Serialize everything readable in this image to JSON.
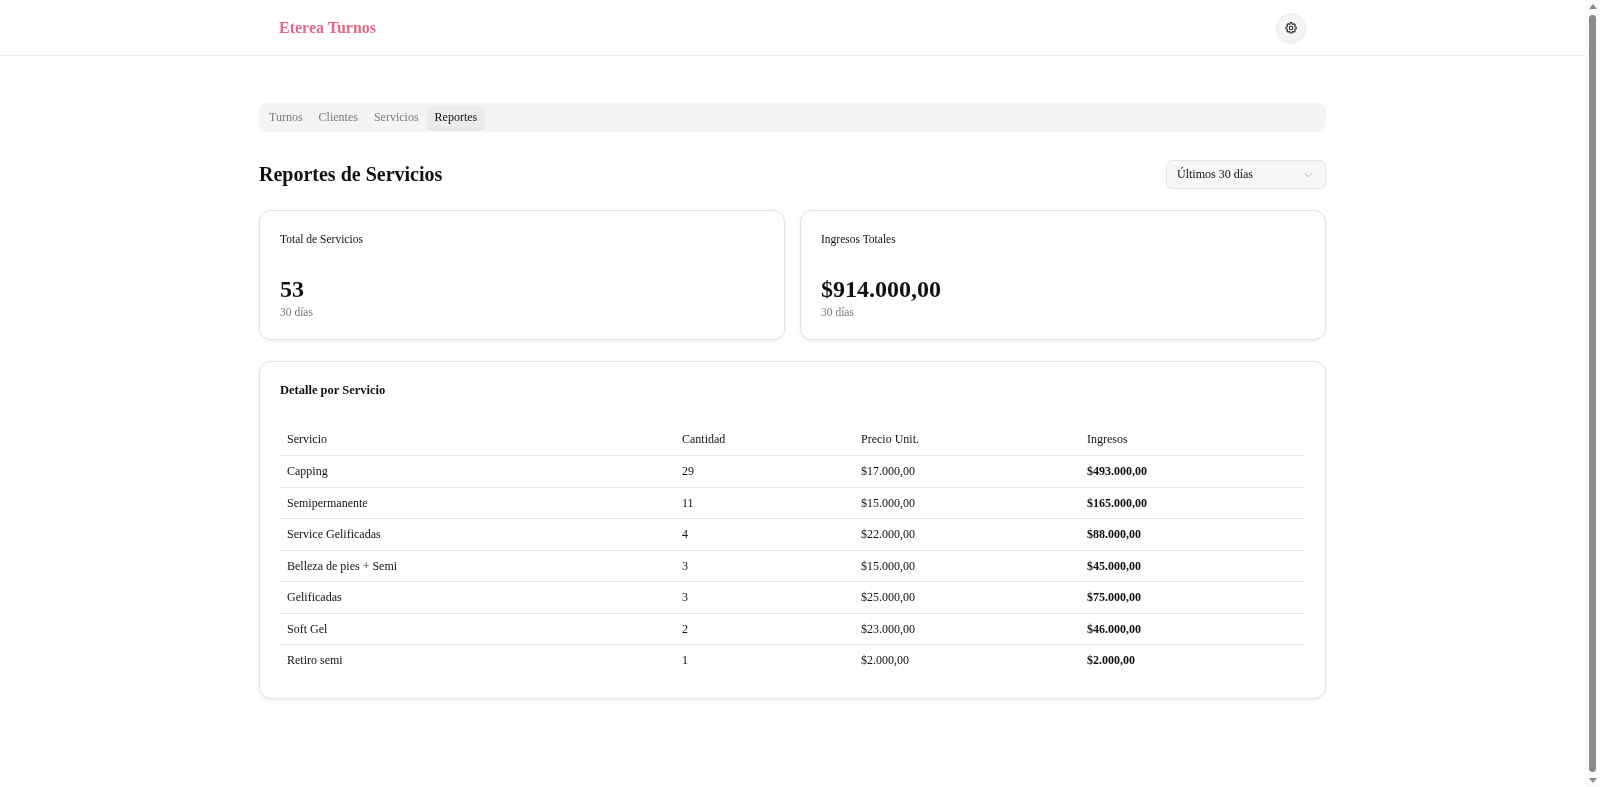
{
  "header": {
    "logo": "Eterea Turnos"
  },
  "tabs": [
    {
      "label": "Turnos",
      "selected": false
    },
    {
      "label": "Clientes",
      "selected": false
    },
    {
      "label": "Servicios",
      "selected": false
    },
    {
      "label": "Reportes",
      "selected": true
    }
  ],
  "page": {
    "title": "Reportes de Servicios",
    "period_select": {
      "value": "Últimos 30 días"
    }
  },
  "stats": [
    {
      "label": "Total de Servicios",
      "value": "53",
      "caption": "30 días"
    },
    {
      "label": "Ingresos Totales",
      "value": "$914.000,00",
      "caption": "30 días"
    }
  ],
  "detail": {
    "title": "Detalle por Servicio",
    "columns": [
      "Servicio",
      "Cantidad",
      "Precio Unit.",
      "Ingresos"
    ],
    "rows": [
      [
        "Capping",
        "29",
        "$17.000,00",
        "$493.000,00"
      ],
      [
        "Semipermanente",
        "11",
        "$15.000,00",
        "$165.000,00"
      ],
      [
        "Service Gelificadas",
        "4",
        "$22.000,00",
        "$88.000,00"
      ],
      [
        "Belleza de pies + Semi",
        "3",
        "$15.000,00",
        "$45.000,00"
      ],
      [
        "Gelificadas",
        "3",
        "$25.000,00",
        "$75.000,00"
      ],
      [
        "Soft Gel",
        "2",
        "$23.000,00",
        "$46.000,00"
      ],
      [
        "Retiro semi",
        "1",
        "$2.000,00",
        "$2.000,00"
      ]
    ]
  }
}
